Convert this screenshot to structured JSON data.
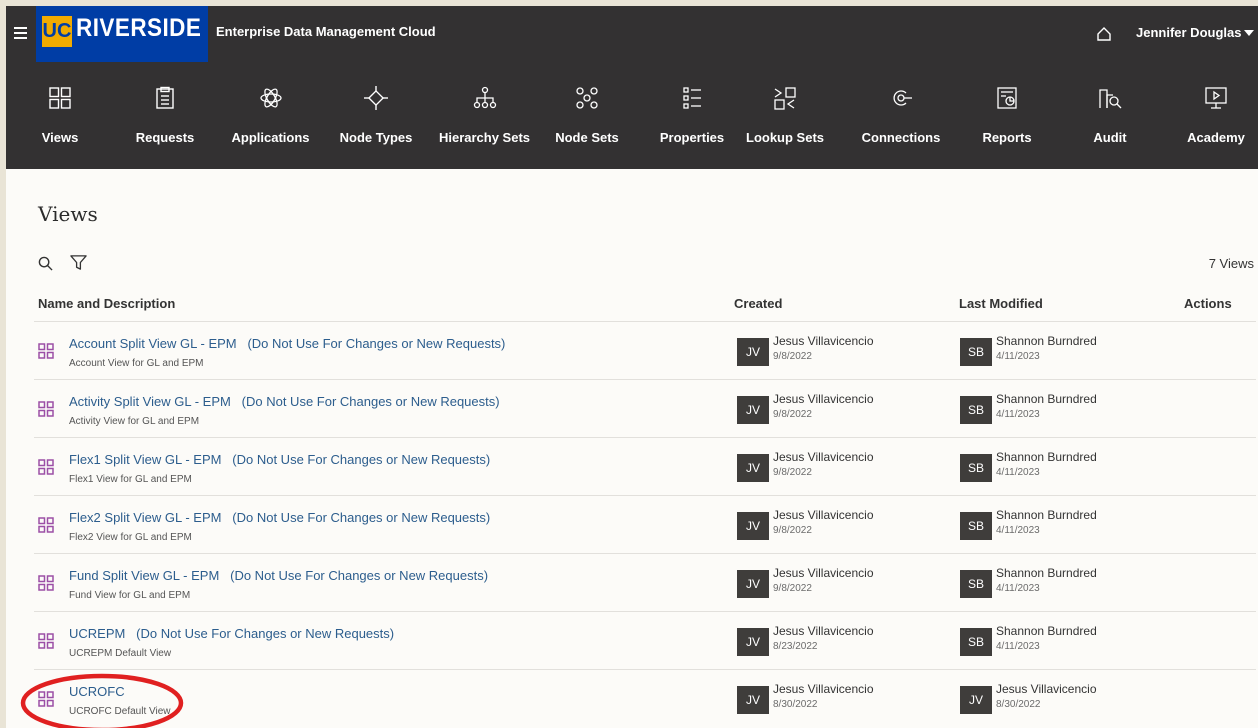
{
  "header": {
    "logo_text": "RIVERSIDE",
    "logo_mark": "UC",
    "app_title": "Enterprise Data Management Cloud",
    "user_name": "Jennifer Douglas"
  },
  "nav": [
    {
      "label": "Views",
      "icon": "views-icon"
    },
    {
      "label": "Requests",
      "icon": "requests-icon"
    },
    {
      "label": "Applications",
      "icon": "applications-icon"
    },
    {
      "label": "Node Types",
      "icon": "node-types-icon"
    },
    {
      "label": "Hierarchy Sets",
      "icon": "hierarchy-sets-icon"
    },
    {
      "label": "Node Sets",
      "icon": "node-sets-icon"
    },
    {
      "label": "Properties",
      "icon": "properties-icon"
    },
    {
      "label": "Lookup Sets",
      "icon": "lookup-sets-icon"
    },
    {
      "label": "Connections",
      "icon": "connections-icon"
    },
    {
      "label": "Reports",
      "icon": "reports-icon"
    },
    {
      "label": "Audit",
      "icon": "audit-icon"
    },
    {
      "label": "Academy",
      "icon": "academy-icon"
    }
  ],
  "page": {
    "title": "Views",
    "count": "7 Views"
  },
  "columns": {
    "name": "Name and Description",
    "created": "Created",
    "modified": "Last Modified",
    "actions": "Actions"
  },
  "rows": [
    {
      "name": "Account Split View GL - EPM   (Do Not Use For Changes or New Requests)",
      "desc": "Account View for GL and EPM",
      "created_initials": "JV",
      "created_by": "Jesus Villavicencio",
      "created_date": "9/8/2022",
      "modified_initials": "SB",
      "modified_by": "Shannon Burndred",
      "modified_date": "4/11/2023"
    },
    {
      "name": "Activity Split View GL - EPM   (Do Not Use For Changes or New Requests)",
      "desc": "Activity View for GL and EPM",
      "created_initials": "JV",
      "created_by": "Jesus Villavicencio",
      "created_date": "9/8/2022",
      "modified_initials": "SB",
      "modified_by": "Shannon Burndred",
      "modified_date": "4/11/2023"
    },
    {
      "name": "Flex1 Split View GL - EPM   (Do Not Use For Changes or New Requests)",
      "desc": "Flex1 View for GL and EPM",
      "created_initials": "JV",
      "created_by": "Jesus Villavicencio",
      "created_date": "9/8/2022",
      "modified_initials": "SB",
      "modified_by": "Shannon Burndred",
      "modified_date": "4/11/2023"
    },
    {
      "name": "Flex2 Split View GL - EPM   (Do Not Use For Changes or New Requests)",
      "desc": "Flex2 View for GL and EPM",
      "created_initials": "JV",
      "created_by": "Jesus Villavicencio",
      "created_date": "9/8/2022",
      "modified_initials": "SB",
      "modified_by": "Shannon Burndred",
      "modified_date": "4/11/2023"
    },
    {
      "name": "Fund Split View GL - EPM   (Do Not Use For Changes or New Requests)",
      "desc": "Fund View for GL and EPM",
      "created_initials": "JV",
      "created_by": "Jesus Villavicencio",
      "created_date": "9/8/2022",
      "modified_initials": "SB",
      "modified_by": "Shannon Burndred",
      "modified_date": "4/11/2023"
    },
    {
      "name": "UCREPM   (Do Not Use For Changes or New Requests)",
      "desc": "UCREPM Default View",
      "created_initials": "JV",
      "created_by": "Jesus Villavicencio",
      "created_date": "8/23/2022",
      "modified_initials": "SB",
      "modified_by": "Shannon Burndred",
      "modified_date": "4/11/2023"
    },
    {
      "name": "UCROFC",
      "desc": "UCROFC Default View",
      "created_initials": "JV",
      "created_by": "Jesus Villavicencio",
      "created_date": "8/30/2022",
      "modified_initials": "JV",
      "modified_by": "Jesus Villavicencio",
      "modified_date": "8/30/2022"
    }
  ],
  "colors": {
    "header_bg": "#333132",
    "logo_bg": "#003da5",
    "logo_gold": "#f1ab00",
    "link": "#2c5d8d",
    "view_icon": "#9b4fa6",
    "highlight": "#e02020"
  }
}
